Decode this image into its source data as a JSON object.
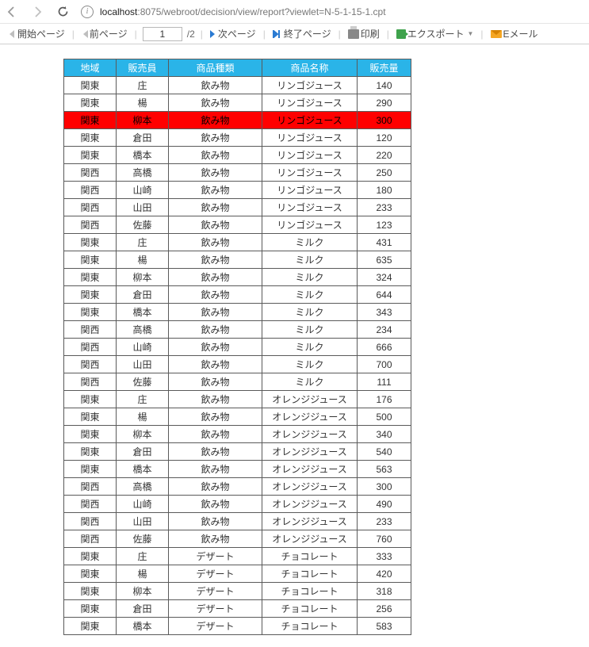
{
  "browser": {
    "url_host": "localhost",
    "url_path": ":8075/webroot/decision/view/report?viewlet=N-5-1-15-1.cpt"
  },
  "toolbar": {
    "first_page": "開始ページ",
    "prev_page": "前ページ",
    "page_total": "/2",
    "current_page": "1",
    "next_page": "次ページ",
    "last_page": "終了ページ",
    "print": "印刷",
    "export": "エクスポート",
    "email": "Eメール"
  },
  "table": {
    "headers": [
      "地域",
      "販売員",
      "商品種類",
      "商品名称",
      "販売量"
    ],
    "rows": [
      {
        "c": [
          "関東",
          "庄",
          "飲み物",
          "リンゴジュース",
          "140"
        ]
      },
      {
        "c": [
          "関東",
          "楊",
          "飲み物",
          "リンゴジュース",
          "290"
        ]
      },
      {
        "c": [
          "関東",
          "柳本",
          "飲み物",
          "リンゴジュース",
          "300"
        ],
        "hl": true
      },
      {
        "c": [
          "関東",
          "倉田",
          "飲み物",
          "リンゴジュース",
          "120"
        ]
      },
      {
        "c": [
          "関東",
          "橋本",
          "飲み物",
          "リンゴジュース",
          "220"
        ]
      },
      {
        "c": [
          "関西",
          "高橋",
          "飲み物",
          "リンゴジュース",
          "250"
        ]
      },
      {
        "c": [
          "関西",
          "山崎",
          "飲み物",
          "リンゴジュース",
          "180"
        ]
      },
      {
        "c": [
          "関西",
          "山田",
          "飲み物",
          "リンゴジュース",
          "233"
        ]
      },
      {
        "c": [
          "関西",
          "佐藤",
          "飲み物",
          "リンゴジュース",
          "123"
        ]
      },
      {
        "c": [
          "関東",
          "庄",
          "飲み物",
          "ミルク",
          "431"
        ]
      },
      {
        "c": [
          "関東",
          "楊",
          "飲み物",
          "ミルク",
          "635"
        ]
      },
      {
        "c": [
          "関東",
          "柳本",
          "飲み物",
          "ミルク",
          "324"
        ]
      },
      {
        "c": [
          "関東",
          "倉田",
          "飲み物",
          "ミルク",
          "644"
        ]
      },
      {
        "c": [
          "関東",
          "橋本",
          "飲み物",
          "ミルク",
          "343"
        ]
      },
      {
        "c": [
          "関西",
          "高橋",
          "飲み物",
          "ミルク",
          "234"
        ]
      },
      {
        "c": [
          "関西",
          "山崎",
          "飲み物",
          "ミルク",
          "666"
        ]
      },
      {
        "c": [
          "関西",
          "山田",
          "飲み物",
          "ミルク",
          "700"
        ]
      },
      {
        "c": [
          "関西",
          "佐藤",
          "飲み物",
          "ミルク",
          "111"
        ]
      },
      {
        "c": [
          "関東",
          "庄",
          "飲み物",
          "オレンジジュース",
          "176"
        ]
      },
      {
        "c": [
          "関東",
          "楊",
          "飲み物",
          "オレンジジュース",
          "500"
        ]
      },
      {
        "c": [
          "関東",
          "柳本",
          "飲み物",
          "オレンジジュース",
          "340"
        ]
      },
      {
        "c": [
          "関東",
          "倉田",
          "飲み物",
          "オレンジジュース",
          "540"
        ]
      },
      {
        "c": [
          "関東",
          "橋本",
          "飲み物",
          "オレンジジュース",
          "563"
        ]
      },
      {
        "c": [
          "関西",
          "高橋",
          "飲み物",
          "オレンジジュース",
          "300"
        ]
      },
      {
        "c": [
          "関西",
          "山崎",
          "飲み物",
          "オレンジジュース",
          "490"
        ]
      },
      {
        "c": [
          "関西",
          "山田",
          "飲み物",
          "オレンジジュース",
          "233"
        ]
      },
      {
        "c": [
          "関西",
          "佐藤",
          "飲み物",
          "オレンジジュース",
          "760"
        ]
      },
      {
        "c": [
          "関東",
          "庄",
          "デザート",
          "チョコレート",
          "333"
        ]
      },
      {
        "c": [
          "関東",
          "楊",
          "デザート",
          "チョコレート",
          "420"
        ]
      },
      {
        "c": [
          "関東",
          "柳本",
          "デザート",
          "チョコレート",
          "318"
        ]
      },
      {
        "c": [
          "関東",
          "倉田",
          "デザート",
          "チョコレート",
          "256"
        ]
      },
      {
        "c": [
          "関東",
          "橋本",
          "デザート",
          "チョコレート",
          "583"
        ]
      }
    ]
  }
}
